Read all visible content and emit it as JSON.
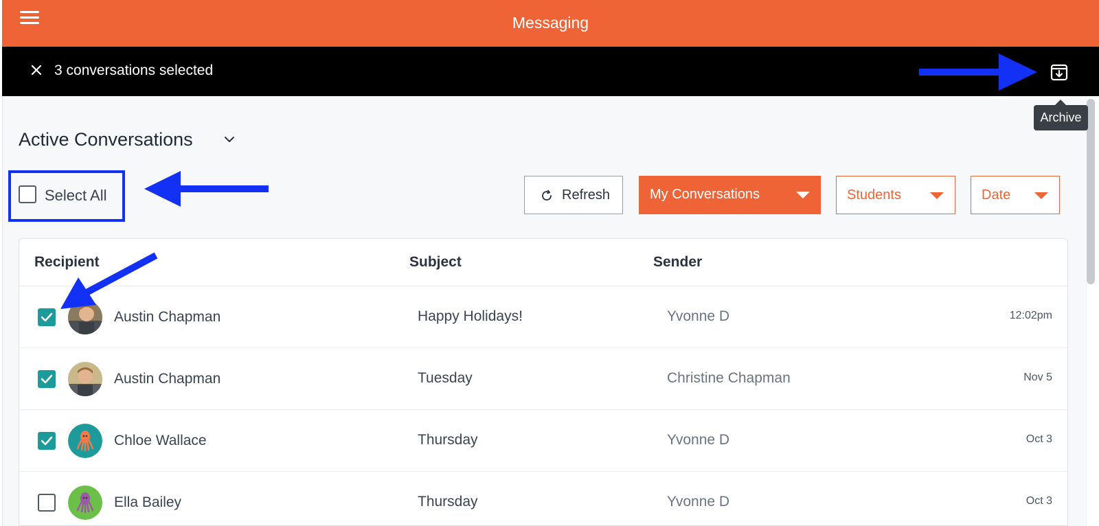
{
  "app": {
    "title": "Messaging"
  },
  "selection_bar": {
    "text": "3 conversations selected",
    "archive_tooltip": "Archive"
  },
  "header": {
    "title": "Active Conversations"
  },
  "toolbar": {
    "select_all_label": "Select All",
    "refresh_label": "Refresh",
    "filter_conversations": "My Conversations",
    "filter_students": "Students",
    "filter_date": "Date"
  },
  "table": {
    "columns": {
      "recipient": "Recipient",
      "subject": "Subject",
      "sender": "Sender"
    },
    "rows": [
      {
        "recipient": "Austin Chapman",
        "subject": "Happy Holidays!",
        "sender": "Yvonne D",
        "date": "12:02pm",
        "checked": true,
        "avatar": "child-photo"
      },
      {
        "recipient": "Austin Chapman",
        "subject": "Tuesday",
        "sender": "Christine Chapman",
        "date": "Nov 5",
        "checked": true,
        "avatar": "child-photo"
      },
      {
        "recipient": "Chloe Wallace",
        "subject": "Thursday",
        "sender": "Yvonne D",
        "date": "Oct 3",
        "checked": true,
        "avatar": "octopus-teal"
      },
      {
        "recipient": "Ella Bailey",
        "subject": "Thursday",
        "sender": "Yvonne D",
        "date": "Oct 3",
        "checked": false,
        "avatar": "octopus-green"
      }
    ]
  },
  "colors": {
    "brand": "#ef6436",
    "checkbox_checked": "#1d9a9a",
    "annotation": "#1330f5"
  }
}
